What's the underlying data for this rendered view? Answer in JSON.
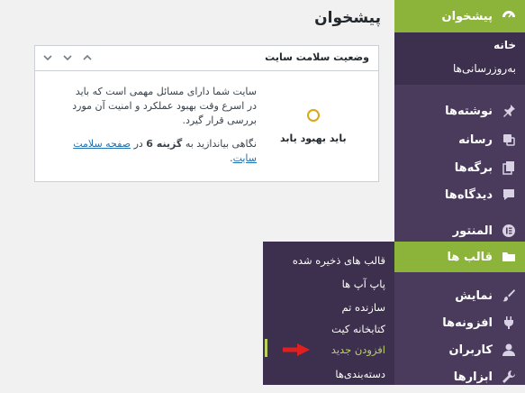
{
  "page": {
    "title": "پیشخوان"
  },
  "widget": {
    "title": "وضعیت سلامت سایت",
    "status_label": "باید بهبود یابد",
    "desc": "سایت شما دارای مسائل مهمی است که باید در اسرع وقت بهبود عملکرد و امنیت آن مورد بررسی قرار گیرد.",
    "hint_prefix": "نگاهی بیاندازید به",
    "hint_bold": "گزینه 6",
    "hint_mid": "در",
    "hint_link": "صفحه سلامت سایت",
    "hint_end": "."
  },
  "sidebar": {
    "dashboard": "پیشخوان",
    "dashboard_sub": [
      "خانه",
      "به‌روزرسانی‌ها"
    ],
    "items": [
      {
        "label": "نوشته‌ها",
        "icon": "pin-icon"
      },
      {
        "label": "رسانه",
        "icon": "media-icon"
      },
      {
        "label": "برگه‌ها",
        "icon": "pages-icon"
      },
      {
        "label": "دیدگاه‌ها",
        "icon": "comments-icon"
      },
      {
        "label": "المنتور",
        "icon": "elementor-icon"
      },
      {
        "label": "قالب ها",
        "icon": "folder-icon"
      },
      {
        "label": "نمایش",
        "icon": "brush-icon"
      },
      {
        "label": "افزونه‌ها",
        "icon": "plug-icon"
      },
      {
        "label": "کاربران",
        "icon": "user-icon"
      },
      {
        "label": "ابزارها",
        "icon": "wrench-icon"
      }
    ]
  },
  "flyout": {
    "items": [
      "قالب های ذخیره شده",
      "پاپ آپ ها",
      "سازنده تم",
      "کتابخانه کیت",
      "افزودن جدید",
      "دسته‌بندی‌ها"
    ]
  },
  "colors": {
    "accent": "#8cb33a",
    "sidebar": "#4a3b5c",
    "submenu": "#3d2f4e",
    "status": "#dba617",
    "arrow": "#e02020"
  }
}
